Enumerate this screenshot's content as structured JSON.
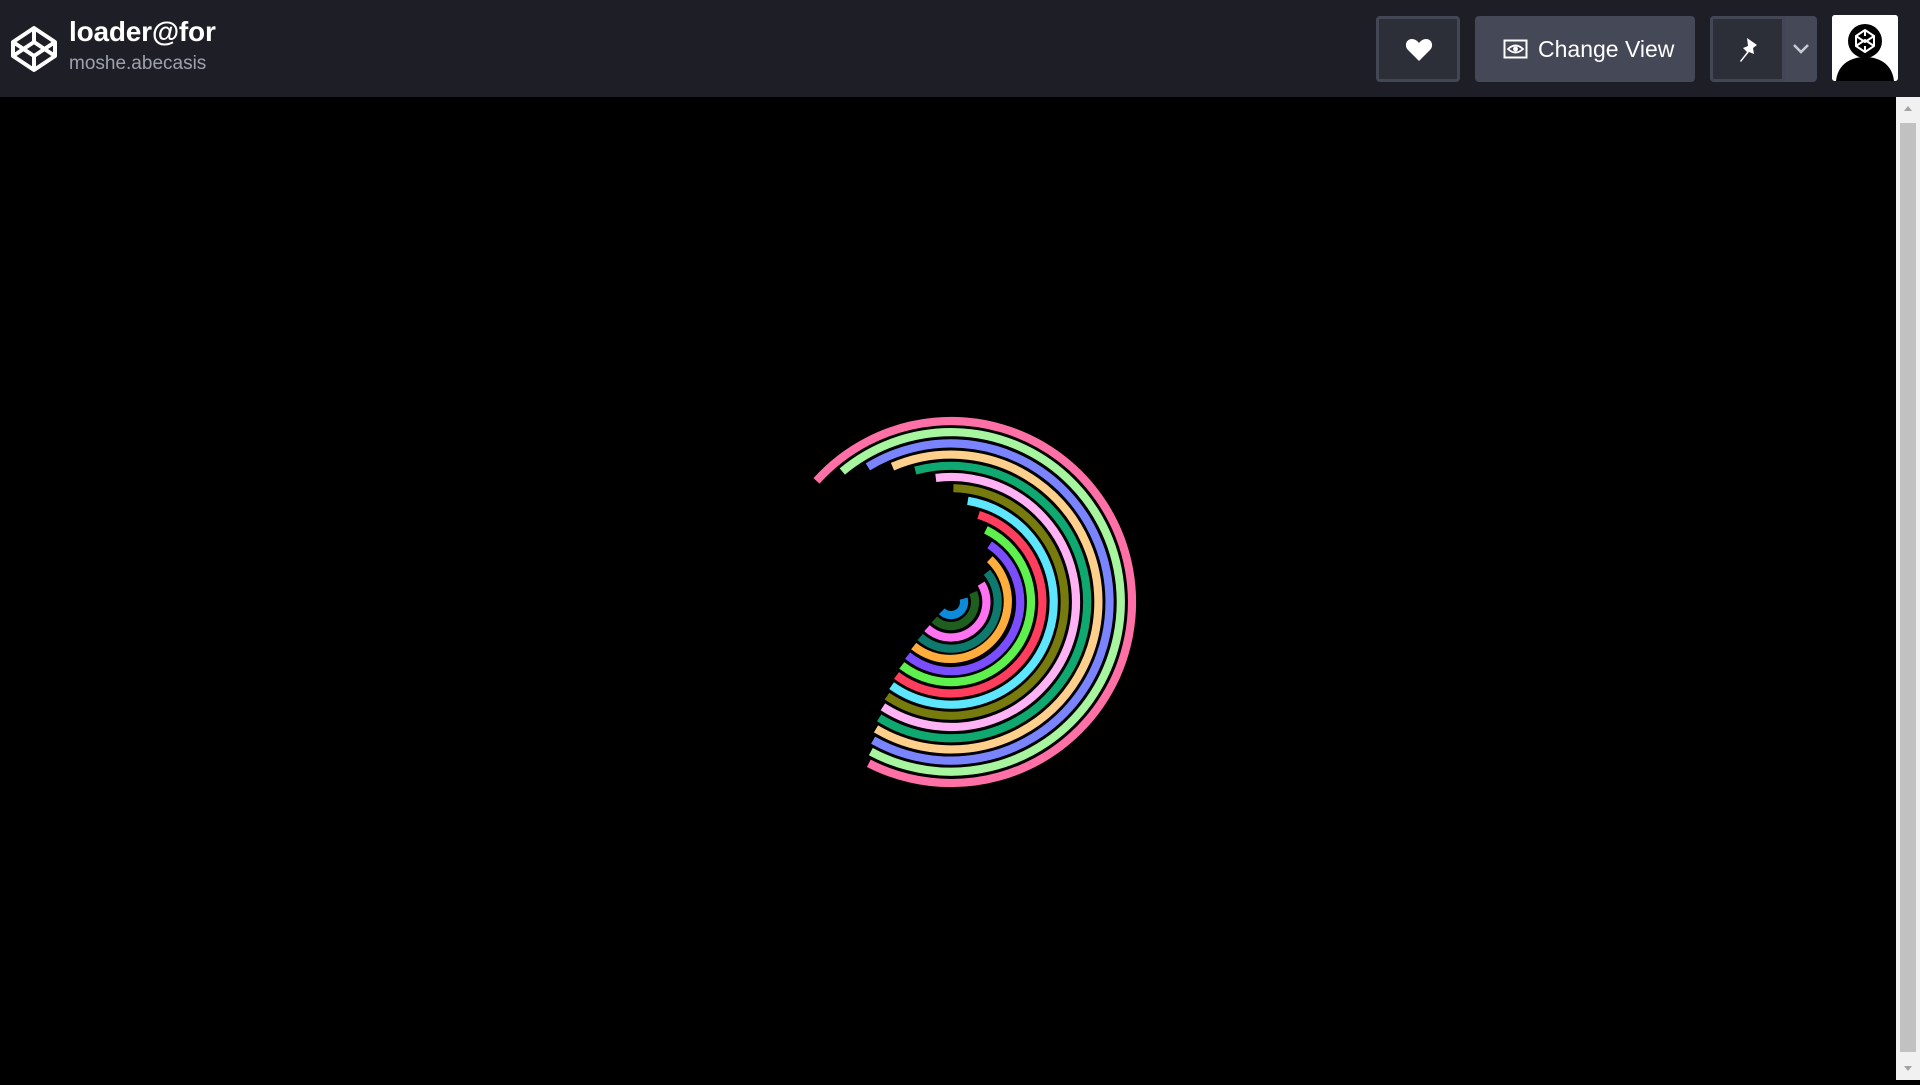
{
  "header": {
    "pen_title": "loader@for",
    "author": "moshe.abecasis",
    "logo_icon": "codepen-logo-icon",
    "heart_icon": "heart-icon",
    "change_view": {
      "icon": "eye-icon",
      "label": "Change View"
    },
    "pin_icon": "pin-icon",
    "dropdown_icon": "chevron-down-icon",
    "avatar_icon": "user-avatar-icon"
  },
  "loader": {
    "arc_colors": [
      "#0b8bd9",
      "#1e5e1e",
      "#ff72f2",
      "#0e7a6e",
      "#ffae3d",
      "#7a4dff",
      "#5ef04d",
      "#ff3d5c",
      "#5ee6ff",
      "#777a0d",
      "#ffb3f5",
      "#0fa870",
      "#ffd08c",
      "#7b84ff",
      "#a8f5a0",
      "#ff70a6"
    ]
  },
  "colors": {
    "topbar_bg": "#1e1f26",
    "button_bg": "#444857",
    "stage_bg": "#000000"
  }
}
